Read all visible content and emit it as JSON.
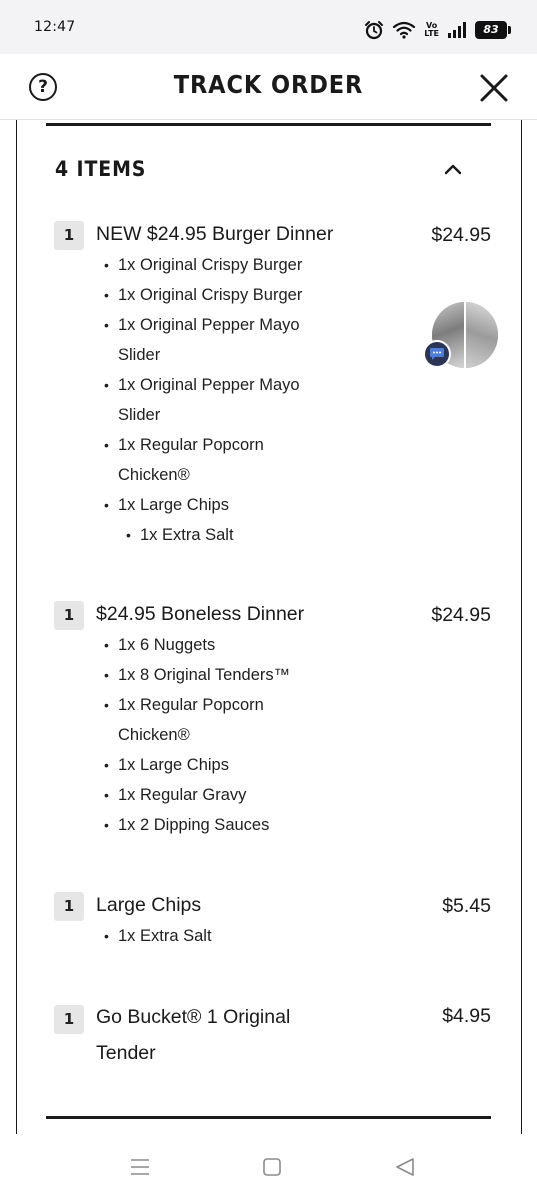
{
  "status_bar": {
    "time": "12:47",
    "volte_top": "Vo",
    "volte_bottom": "LTE",
    "battery": "83"
  },
  "header": {
    "help_label": "?",
    "title": "TRACK ORDER"
  },
  "order": {
    "items_heading": "4 ITEMS",
    "items": [
      {
        "qty": "1",
        "name": "NEW $24.95 Burger Dinner",
        "price": "$24.95",
        "modifiers": [
          "1x Original Crispy Burger",
          "1x Original Crispy Burger",
          "1x Original Pepper Mayo Slider",
          "1x Original Pepper Mayo Slider",
          "1x Regular Popcorn Chicken®",
          "1x Large Chips",
          "1x Extra Salt"
        ]
      },
      {
        "qty": "1",
        "name": "$24.95 Boneless Dinner",
        "price": "$24.95",
        "modifiers": [
          "1x 6 Nuggets",
          "1x 8 Original Tenders™",
          "1x Regular Popcorn Chicken®",
          "1x Large Chips",
          "1x Regular Gravy",
          "1x 2 Dipping Sauces"
        ]
      },
      {
        "qty": "1",
        "name": "Large Chips",
        "price": "$5.45",
        "modifiers": [
          "1x Extra Salt"
        ]
      },
      {
        "qty": "1",
        "name": "Go Bucket® 1 Original Tender",
        "price": "$4.95",
        "modifiers": []
      }
    ]
  },
  "icons": {
    "help": "question-circle-icon",
    "close": "close-icon",
    "collapse": "chevron-up-icon",
    "chat": "chat-bubble-icon",
    "nav_recents": "menu-lines-icon",
    "nav_home": "square-icon",
    "nav_back": "triangle-back-icon"
  },
  "colors": {
    "text": "#1a1a1a",
    "status_bar_bg": "#f3f3f5",
    "qty_badge_bg": "#e6e6e6",
    "chat_badge_bg": "#2b3556"
  }
}
